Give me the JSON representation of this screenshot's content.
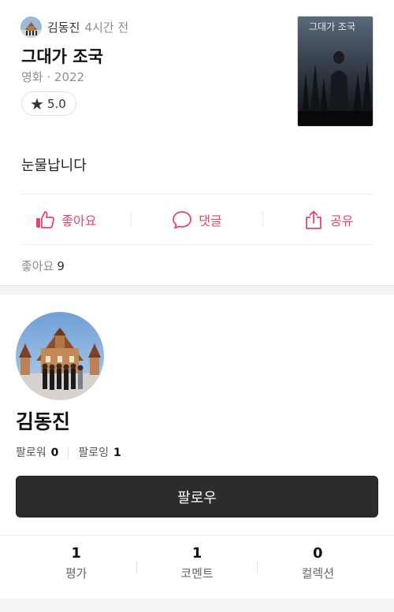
{
  "review": {
    "author_name": "김동진",
    "time_ago": "4시간 전",
    "title": "그대가 조국",
    "meta": "영화 · 2022",
    "rating": "5.0",
    "body": "눈물납니다",
    "poster_text": "그대가 조국",
    "actions": {
      "like_label": "좋아요",
      "comment_label": "댓글",
      "share_label": "공유"
    },
    "likes_label": "좋아요",
    "likes_count": "9"
  },
  "profile": {
    "name": "김동진",
    "followers_label": "팔로워",
    "followers_count": "0",
    "following_label": "팔로잉",
    "following_count": "1",
    "follow_button": "팔로우",
    "stats": [
      {
        "value": "1",
        "label": "평가"
      },
      {
        "value": "1",
        "label": "코멘트"
      },
      {
        "value": "0",
        "label": "컬렉션"
      }
    ]
  },
  "colors": {
    "accent": "#e8456b",
    "button_dark": "#2c2c2e"
  },
  "icons": [
    "star-icon",
    "thumbs-up-icon",
    "speech-bubble-icon",
    "share-icon"
  ]
}
